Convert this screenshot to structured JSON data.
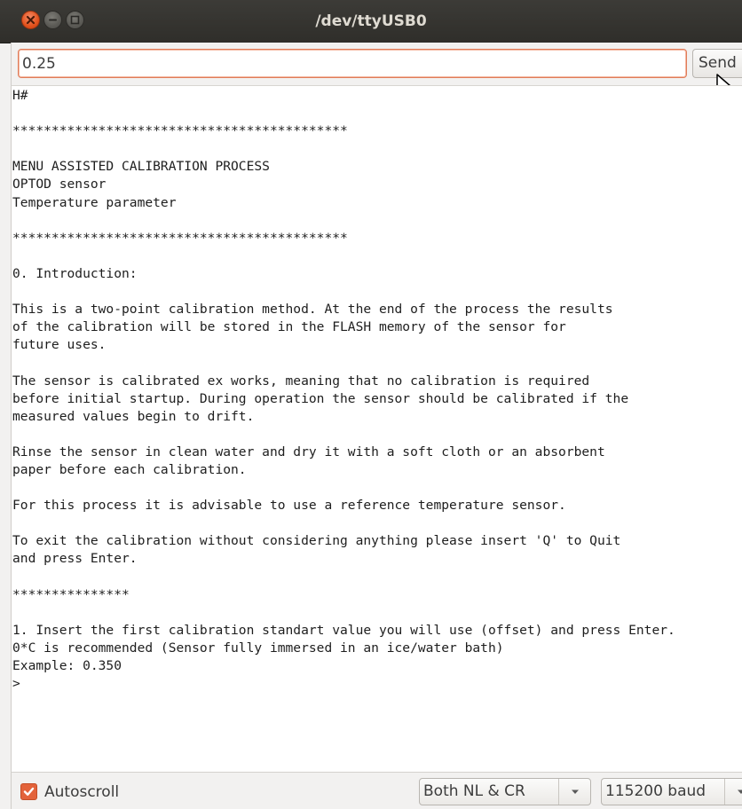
{
  "window": {
    "title": "/dev/ttyUSB0"
  },
  "input": {
    "value": "0.25",
    "send_label": "Send"
  },
  "console": {
    "lines": [
      "H#",
      "",
      "*******************************************",
      "",
      "MENU ASSISTED CALIBRATION PROCESS",
      "OPTOD sensor",
      "Temperature parameter",
      "",
      "*******************************************",
      "",
      "0. Introduction:",
      "",
      "This is a two-point calibration method. At the end of the process the results",
      "of the calibration will be stored in the FLASH memory of the sensor for",
      "future uses.",
      "",
      "The sensor is calibrated ex works, meaning that no calibration is required",
      "before initial startup. During operation the sensor should be calibrated if the",
      "measured values begin to drift.",
      "",
      "Rinse the sensor in clean water and dry it with a soft cloth or an absorbent",
      "paper before each calibration.",
      "",
      "For this process it is advisable to use a reference temperature sensor.",
      "",
      "To exit the calibration without considering anything please insert 'Q' to Quit",
      "and press Enter.",
      "",
      "***************",
      "",
      "1. Insert the first calibration standart value you will use (offset) and press Enter.",
      "0*C is recommended (Sensor fully immersed in an ice/water bath)",
      "Example: 0.350",
      ">"
    ]
  },
  "status": {
    "autoscroll_label": "Autoscroll",
    "autoscroll_checked": true,
    "line_ending": "Both NL & CR",
    "baud_rate": "115200 baud"
  },
  "colors": {
    "accent": "#e3633b",
    "titlebar": "#3c3b37"
  }
}
